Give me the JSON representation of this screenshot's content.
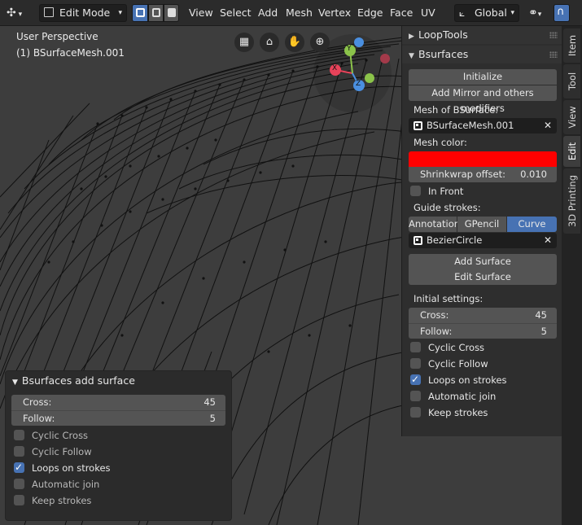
{
  "header": {
    "mode": "Edit Mode",
    "menus": [
      "View",
      "Select",
      "Add",
      "Mesh",
      "Vertex",
      "Edge",
      "Face",
      "UV"
    ],
    "orientation": "Global"
  },
  "viewport": {
    "perspective": "User Perspective",
    "object": "(1) BSurfaceMesh.001",
    "gizmo": {
      "x": "X",
      "y": "Y",
      "z": "Z"
    }
  },
  "npanel": {
    "looptools": "LoopTools",
    "bsurfaces": "Bsurfaces",
    "initialize": "Initialize",
    "add_mirror": "Add Mirror and others modifiers",
    "mesh_of_label": "Mesh of BSurface:",
    "mesh_of_value": "BSurfaceMesh.001",
    "mesh_color_label": "Mesh color:",
    "mesh_color": "#ff0000",
    "shrinkwrap_label": "Shrinkwrap offset:",
    "shrinkwrap_value": "0.010",
    "in_front": "In Front",
    "guide_label": "Guide strokes:",
    "guide_tabs": [
      "Annotation",
      "GPencil",
      "Curve"
    ],
    "curve_value": "BezierCircle",
    "add_surface": "Add Surface",
    "edit_surface": "Edit Surface",
    "initial_label": "Initial settings:",
    "cross_label": "Cross:",
    "cross_value": "45",
    "follow_label": "Follow:",
    "follow_value": "5",
    "cyclic_cross": "Cyclic Cross",
    "cyclic_follow": "Cyclic Follow",
    "loops_on_strokes": "Loops on strokes",
    "automatic_join": "Automatic join",
    "keep_strokes": "Keep strokes"
  },
  "tabs": [
    "Item",
    "Tool",
    "View",
    "Edit",
    "3D Printing"
  ],
  "redo": {
    "title": "Bsurfaces add surface",
    "cross_label": "Cross:",
    "cross_value": "45",
    "follow_label": "Follow:",
    "follow_value": "5",
    "cyclic_cross": "Cyclic Cross",
    "cyclic_follow": "Cyclic Follow",
    "loops_on_strokes": "Loops on strokes",
    "automatic_join": "Automatic join",
    "keep_strokes": "Keep strokes"
  },
  "colors": {
    "accent": "#4772b3",
    "axis_x": "#e8435a",
    "axis_y": "#8bc34a",
    "axis_z": "#4a8fe0"
  }
}
